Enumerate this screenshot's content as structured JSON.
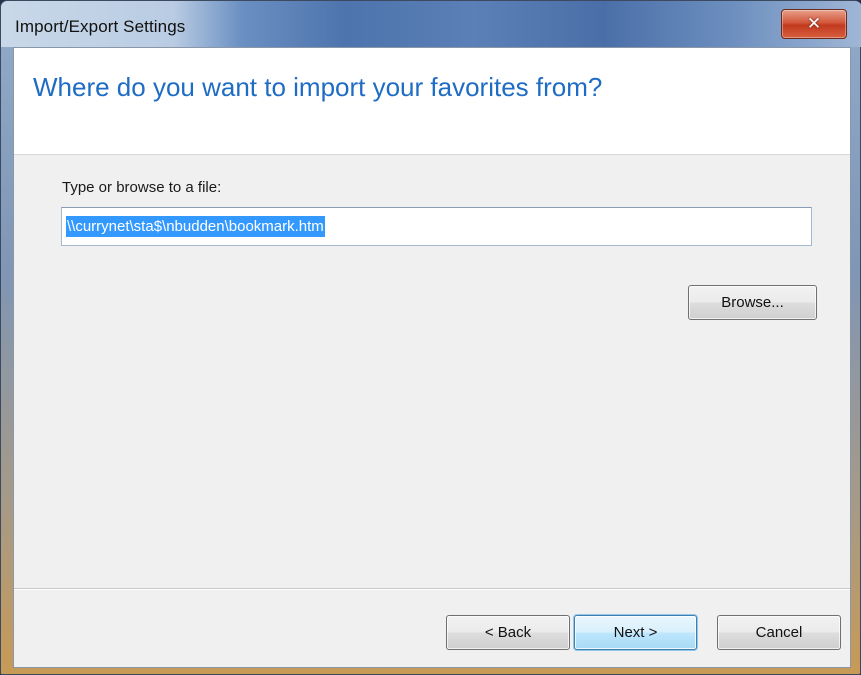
{
  "window": {
    "title": "Import/Export Settings",
    "close_glyph": "✕"
  },
  "header": {
    "title": "Where do you want to import your favorites from?"
  },
  "file_picker": {
    "label": "Type or browse to a file:",
    "value": "\\\\currynet\\sta$\\nbudden\\bookmark.htm",
    "browse_label": "Browse..."
  },
  "footer": {
    "back_label": "< Back",
    "next_label": "Next >",
    "cancel_label": "Cancel"
  },
  "colors": {
    "header_title": "#1f6cc4",
    "selection": "#3399ff",
    "close_button": "#c23a1f"
  },
  "icons": {
    "close": "close-icon"
  }
}
